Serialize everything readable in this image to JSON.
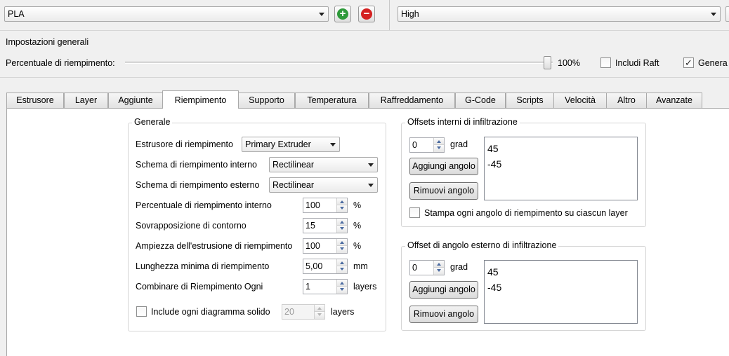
{
  "top": {
    "material_select": "PLA",
    "quality_select": "High"
  },
  "general": {
    "title": "Impostazioni generali",
    "infill_label": "Percentuale di riempimento:",
    "infill_value": "100%",
    "infill_fraction": 1.0,
    "raft_label": "Includi Raft",
    "raft_checked": false,
    "genera_label": "Genera",
    "genera_checked": true
  },
  "tabs": [
    "Estrusore",
    "Layer",
    "Aggiunte",
    "Riempimento",
    "Supporto",
    "Temperatura",
    "Raffreddamento",
    "G-Code",
    "Scripts",
    "Velocità",
    "Altro",
    "Avanzate"
  ],
  "active_tab": "Riempimento",
  "generale": {
    "title": "Generale",
    "extruder_label": "Estrusore di riempimento",
    "extruder_value": "Primary Extruder",
    "internal_pattern_label": "Schema di riempimento interno",
    "internal_pattern_value": "Rectilinear",
    "external_pattern_label": "Schema di riempimento esterno",
    "external_pattern_value": "Rectilinear",
    "internal_pct_label": "Percentuale di riempimento interno",
    "internal_pct_value": "100",
    "internal_pct_unit": "%",
    "overlap_label": "Sovrapposizione di contorno",
    "overlap_value": "15",
    "overlap_unit": "%",
    "extrusion_width_label": "Ampiezza dell'estrusione di riempimento",
    "extrusion_width_value": "100",
    "extrusion_width_unit": "%",
    "min_length_label": "Lunghezza minima di riempimento",
    "min_length_value": "5,00",
    "min_length_unit": "mm",
    "combine_label": "Combinare di Riempimento Ogni",
    "combine_value": "1",
    "combine_unit": "layers",
    "solid_label": "Include ogni diagramma solido",
    "solid_checked": false,
    "solid_value": "20",
    "solid_unit": "layers"
  },
  "internal_offsets": {
    "title": "Offsets interni di infiltrazione",
    "angle_value": "0",
    "angle_unit": "grad",
    "add_button": "Aggiungi angolo",
    "remove_button": "Rimuovi angolo",
    "angles": [
      "45",
      "-45"
    ],
    "print_every_label": "Stampa ogni angolo di riempimento su ciascun layer",
    "print_every_checked": false
  },
  "external_offsets": {
    "title": "Offset di angolo esterno di infiltrazione",
    "angle_value": "0",
    "angle_unit": "grad",
    "add_button": "Aggiungi angolo",
    "remove_button": "Rimuovi angolo",
    "angles": [
      "45",
      "-45"
    ]
  },
  "colors": {
    "add_green": "#2e9a3a",
    "remove_red": "#d42020",
    "check_mark": "#2b2b2b"
  }
}
